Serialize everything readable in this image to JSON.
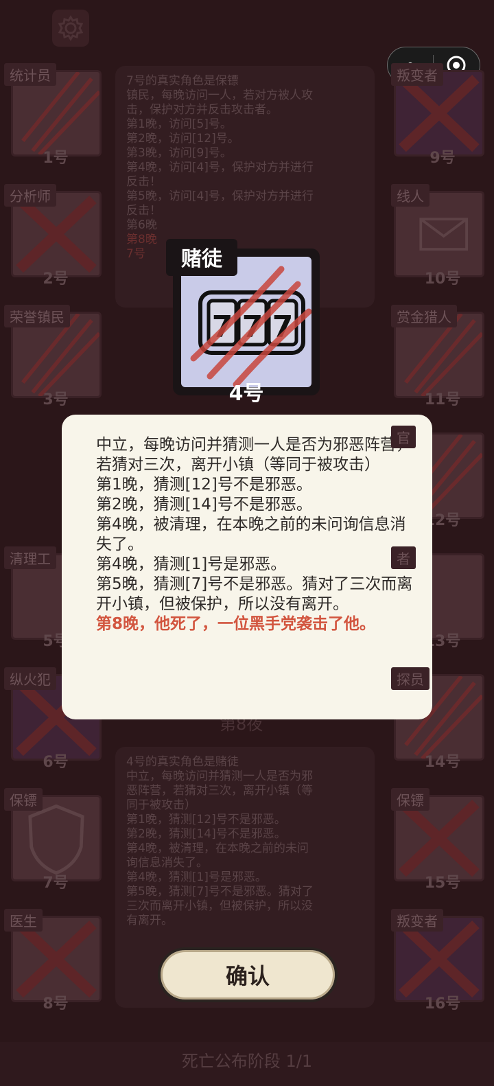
{
  "top": {
    "gear_icon": "gear-icon",
    "more_icon": "more-dots-icon",
    "close_icon": "target-icon"
  },
  "players_left": [
    {
      "role": "统计员",
      "num": "1号",
      "dead": true
    },
    {
      "role": "分析师",
      "num": "2号",
      "dead": true
    },
    {
      "role": "荣誉镇民",
      "num": "3号",
      "dead": true
    },
    {
      "role": "清理工",
      "num": "5号",
      "dead": false
    },
    {
      "role": "纵火犯",
      "num": "6号",
      "dead": true
    },
    {
      "role": "保镖",
      "num": "7号",
      "dead": false
    },
    {
      "role": "医生",
      "num": "8号",
      "dead": true
    }
  ],
  "players_right": [
    {
      "role": "叛变者",
      "num": "9号",
      "dead": true
    },
    {
      "role": "线人",
      "num": "10号",
      "dead": false
    },
    {
      "role": "赏金猎人",
      "num": "11号",
      "dead": true
    },
    {
      "role": "官",
      "num": "12号",
      "dead": true
    },
    {
      "role": "者",
      "num": "13号",
      "dead": false
    },
    {
      "role": "探员",
      "num": "14号",
      "dead": true
    },
    {
      "role": "保镖",
      "num": "15号",
      "dead": true
    },
    {
      "role": "叛变者",
      "num": "16号",
      "dead": true
    }
  ],
  "log_top": {
    "lines": [
      "7号的真实角色是保镖",
      "镇民，每晚访问一人，若对方被人攻",
      "击，保护对方并反击攻击者。",
      "第1晚，访问[5]号。",
      "第2晚，访问[12]号。",
      "第3晚，访问[9]号。",
      "第4晚，访问[4]号，保护对方并进行",
      "反击！",
      "第5晚，访问[4]号，保护对方并进行",
      "反击！",
      "第6晚"
    ],
    "red_lines": [
      "第8晚",
      "7号"
    ]
  },
  "night_label": "第8夜",
  "log_bottom": {
    "lines": [
      "4号的真实角色是赌徒",
      "中立，每晚访问并猜测一人是否为邪",
      "恶阵营，若猜对三次，离开小镇（等",
      "同于被攻击）",
      "第1晚，猜测[12]号不是邪恶。",
      "第2晚，猜测[14]号不是邪恶。",
      "第4晚，被清理，在本晚之前的未问",
      "询信息消失了。",
      "第4晚，猜测[1]号是邪恶。",
      "第5晚，猜测[7]号不是邪恶。猜对了",
      "三次而离开小镇，但被保护，所以没",
      "有离开。"
    ]
  },
  "focus": {
    "role": "赌徒",
    "num": "4号",
    "icon": "slot-machine-777-icon",
    "digits": "777"
  },
  "popup": {
    "lines": [
      "中立，每晚访问并猜测一人是否为邪恶阵营，若猜对三次，离开小镇（等同于被攻击）",
      "第1晚，猜测[12]号不是邪恶。",
      "第2晚，猜测[14]号不是邪恶。",
      "第4晚，被清理，在本晚之前的未问询信息消失了。",
      "第4晚，猜测[1]号是邪恶。",
      "第5晚，猜测[7]号不是邪恶。猜对了三次而离开小镇，但被保护，所以没有离开。"
    ],
    "death_line": "第8晚，他死了，一位黑手党袭击了他。"
  },
  "confirm_label": "确认",
  "phase_label": "死亡公布阶段 1/1",
  "colors": {
    "popup_bg": "#f8f5ea",
    "death_red": "#d2553f",
    "role_bg": "#c9cbe8"
  }
}
